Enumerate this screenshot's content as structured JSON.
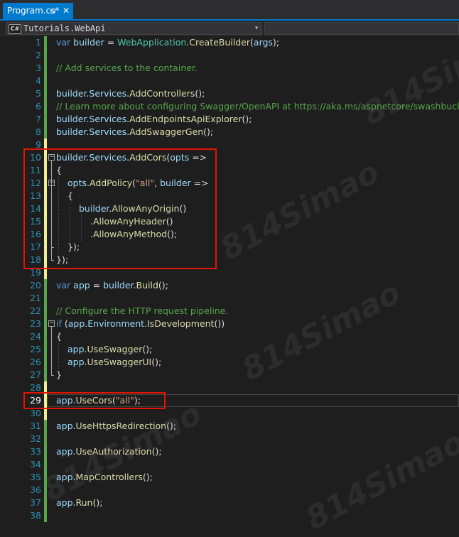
{
  "tab": {
    "title": "Program.cs*",
    "pin": "⊕",
    "close": "✕"
  },
  "navbar": {
    "project": "Tutorials.WebApi",
    "lang_badge": "C#",
    "arrow": "▾"
  },
  "watermark": "814Simao",
  "editor": {
    "current_line": 29,
    "lines": [
      {
        "n": "1",
        "tokens": [
          [
            "kw",
            "var "
          ],
          [
            "id",
            "builder"
          ],
          [
            "pl",
            " = "
          ],
          [
            "ty",
            "WebApplication"
          ],
          [
            "pl",
            "."
          ],
          [
            "me",
            "CreateBuilder"
          ],
          [
            "pl",
            "("
          ],
          [
            "id",
            "args"
          ],
          [
            "pl",
            ");"
          ]
        ]
      },
      {
        "n": "2",
        "tokens": []
      },
      {
        "n": "3",
        "tokens": [
          [
            "cm",
            "// Add services to the container."
          ]
        ]
      },
      {
        "n": "4",
        "tokens": []
      },
      {
        "n": "5",
        "tokens": [
          [
            "id",
            "builder"
          ],
          [
            "pl",
            "."
          ],
          [
            "id",
            "Services"
          ],
          [
            "pl",
            "."
          ],
          [
            "me",
            "AddControllers"
          ],
          [
            "pl",
            "();"
          ]
        ]
      },
      {
        "n": "6",
        "tokens": [
          [
            "cm",
            "// Learn more about configuring Swagger/OpenAPI at https://aka.ms/aspnetcore/swashbuckle"
          ]
        ]
      },
      {
        "n": "7",
        "tokens": [
          [
            "id",
            "builder"
          ],
          [
            "pl",
            "."
          ],
          [
            "id",
            "Services"
          ],
          [
            "pl",
            "."
          ],
          [
            "me",
            "AddEndpointsApiExplorer"
          ],
          [
            "pl",
            "();"
          ]
        ]
      },
      {
        "n": "8",
        "tokens": [
          [
            "id",
            "builder"
          ],
          [
            "pl",
            "."
          ],
          [
            "id",
            "Services"
          ],
          [
            "pl",
            "."
          ],
          [
            "me",
            "AddSwaggerGen"
          ],
          [
            "pl",
            "();"
          ]
        ]
      },
      {
        "n": "9",
        "tokens": []
      },
      {
        "n": "10",
        "tokens": [
          [
            "id",
            "builder"
          ],
          [
            "pl",
            "."
          ],
          [
            "id",
            "Services"
          ],
          [
            "pl",
            "."
          ],
          [
            "me",
            "AddCors"
          ],
          [
            "pl",
            "("
          ],
          [
            "id",
            "opts"
          ],
          [
            "pl",
            " =>"
          ]
        ]
      },
      {
        "n": "11",
        "tokens": [
          [
            "pl",
            "{"
          ]
        ]
      },
      {
        "n": "12",
        "tokens": [
          [
            "id",
            "opts"
          ],
          [
            "pl",
            "."
          ],
          [
            "me",
            "AddPolicy"
          ],
          [
            "pl",
            "("
          ],
          [
            "st",
            "\"all\""
          ],
          [
            "pl",
            ", "
          ],
          [
            "id",
            "builder"
          ],
          [
            "pl",
            " =>"
          ]
        ]
      },
      {
        "n": "13",
        "tokens": [
          [
            "pl",
            "{"
          ]
        ]
      },
      {
        "n": "14",
        "tokens": [
          [
            "id",
            "builder"
          ],
          [
            "pl",
            "."
          ],
          [
            "me",
            "AllowAnyOrigin"
          ],
          [
            "pl",
            "()"
          ]
        ]
      },
      {
        "n": "15",
        "tokens": [
          [
            "pl",
            "."
          ],
          [
            "me",
            "AllowAnyHeader"
          ],
          [
            "pl",
            "()"
          ]
        ]
      },
      {
        "n": "16",
        "tokens": [
          [
            "pl",
            "."
          ],
          [
            "me",
            "AllowAnyMethod"
          ],
          [
            "pl",
            "();"
          ]
        ]
      },
      {
        "n": "17",
        "tokens": [
          [
            "pl",
            "});"
          ]
        ]
      },
      {
        "n": "18",
        "tokens": [
          [
            "pl",
            "});"
          ]
        ]
      },
      {
        "n": "19",
        "tokens": []
      },
      {
        "n": "20",
        "tokens": [
          [
            "kw",
            "var "
          ],
          [
            "id",
            "app"
          ],
          [
            "pl",
            " = "
          ],
          [
            "id",
            "builder"
          ],
          [
            "pl",
            "."
          ],
          [
            "me",
            "Build"
          ],
          [
            "pl",
            "();"
          ]
        ]
      },
      {
        "n": "21",
        "tokens": []
      },
      {
        "n": "22",
        "tokens": [
          [
            "cm",
            "// Configure the HTTP request pipeline."
          ]
        ]
      },
      {
        "n": "23",
        "tokens": [
          [
            "kw",
            "if "
          ],
          [
            "pl",
            "("
          ],
          [
            "id",
            "app"
          ],
          [
            "pl",
            "."
          ],
          [
            "id",
            "Environment"
          ],
          [
            "pl",
            "."
          ],
          [
            "me",
            "IsDevelopment"
          ],
          [
            "pl",
            "())"
          ]
        ]
      },
      {
        "n": "24",
        "tokens": [
          [
            "pl",
            "{"
          ]
        ]
      },
      {
        "n": "25",
        "tokens": [
          [
            "id",
            "app"
          ],
          [
            "pl",
            "."
          ],
          [
            "me",
            "UseSwagger"
          ],
          [
            "pl",
            "();"
          ]
        ]
      },
      {
        "n": "26",
        "tokens": [
          [
            "id",
            "app"
          ],
          [
            "pl",
            "."
          ],
          [
            "me",
            "UseSwaggerUI"
          ],
          [
            "pl",
            "();"
          ]
        ]
      },
      {
        "n": "27",
        "tokens": [
          [
            "pl",
            "}"
          ]
        ]
      },
      {
        "n": "28",
        "tokens": []
      },
      {
        "n": "29",
        "tokens": [
          [
            "id",
            "app"
          ],
          [
            "pl",
            "."
          ],
          [
            "me",
            "UseCors"
          ],
          [
            "pl",
            "("
          ],
          [
            "st",
            "\"all\""
          ],
          [
            "pl",
            ");"
          ]
        ]
      },
      {
        "n": "30",
        "tokens": []
      },
      {
        "n": "31",
        "tokens": [
          [
            "id",
            "app"
          ],
          [
            "pl",
            "."
          ],
          [
            "me",
            "UseHttpsRedirection"
          ],
          [
            "pl",
            "();"
          ]
        ]
      },
      {
        "n": "32",
        "tokens": []
      },
      {
        "n": "33",
        "tokens": [
          [
            "id",
            "app"
          ],
          [
            "pl",
            "."
          ],
          [
            "me",
            "UseAuthorization"
          ],
          [
            "pl",
            "();"
          ]
        ]
      },
      {
        "n": "34",
        "tokens": []
      },
      {
        "n": "35",
        "tokens": [
          [
            "id",
            "app"
          ],
          [
            "pl",
            "."
          ],
          [
            "me",
            "MapControllers"
          ],
          [
            "pl",
            "();"
          ]
        ]
      },
      {
        "n": "36",
        "tokens": []
      },
      {
        "n": "37",
        "tokens": [
          [
            "id",
            "app"
          ],
          [
            "pl",
            "."
          ],
          [
            "me",
            "Run"
          ],
          [
            "pl",
            "();"
          ]
        ]
      },
      {
        "n": "38",
        "tokens": []
      }
    ]
  }
}
